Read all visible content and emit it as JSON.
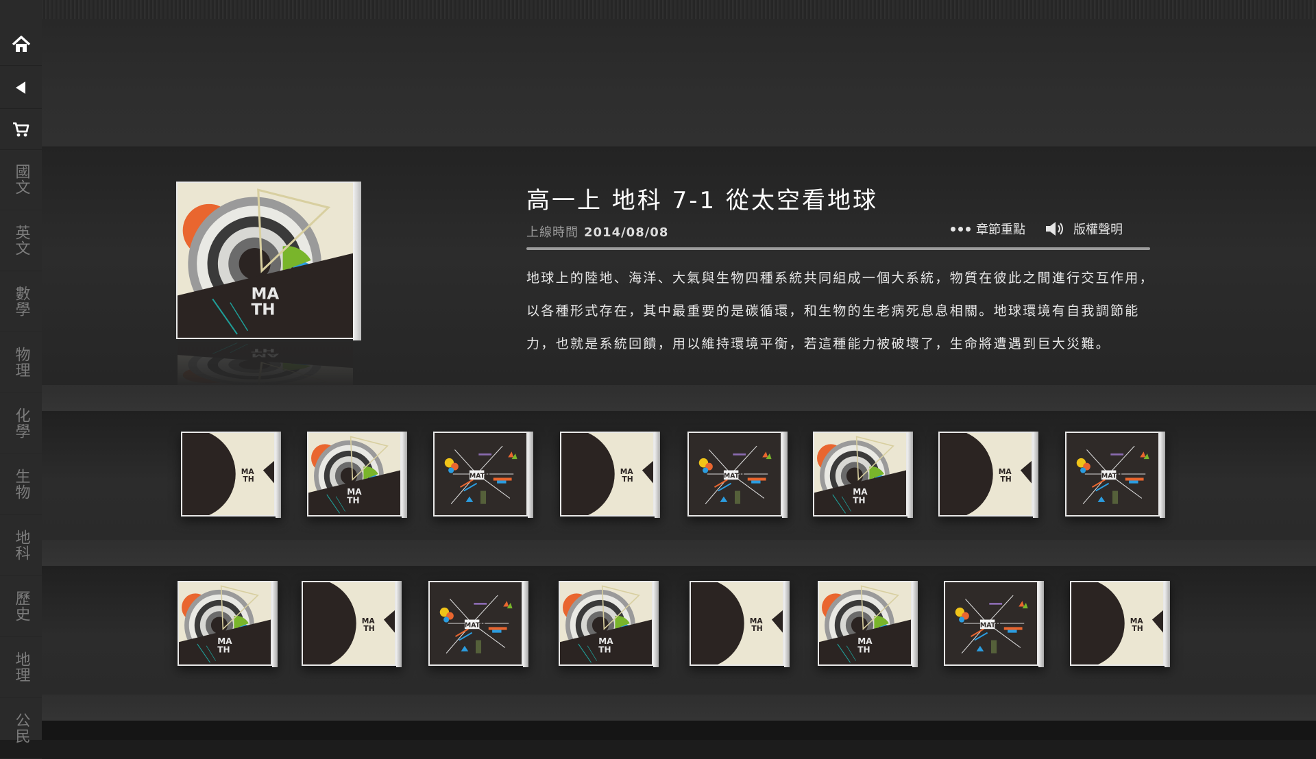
{
  "sidebar": {
    "icons": [
      "home-icon",
      "back-icon",
      "cart-icon"
    ],
    "subjects": [
      "國文",
      "英文",
      "數學",
      "物理",
      "化學",
      "生物",
      "地科",
      "歷史",
      "地理",
      "公民"
    ]
  },
  "book": {
    "title": "高一上 地科 7-1 從太空看地球",
    "date_label": "上線時間",
    "date": "2014/08/08",
    "action_chapter": "章節重點",
    "action_copyright": "版權聲明",
    "description": "地球上的陸地、海洋、大氣與生物四種系統共同組成一個大系統，物質在彼此之間進行交互作用，以各種形式存在，其中最重要的是碳循環，和生物的生老病死息息相關。地球環境有自我調節能力，也就是系統回饋，用以維持環境平衡，若這種能力被破壞了，生命將遭遇到巨大災難。",
    "cover_text": "MATH"
  },
  "shelves": {
    "row1": [
      "half-circle",
      "arcs",
      "burst",
      "half-circle",
      "burst",
      "arcs",
      "half-circle",
      "burst"
    ],
    "row2": [
      "arcs",
      "half-circle",
      "burst",
      "arcs",
      "half-circle",
      "arcs",
      "burst",
      "half-circle"
    ]
  },
  "colors": {
    "cover_bg": "#ebe6d2",
    "cover_dark": "#2b2422",
    "cover_orange": "#e9662f",
    "cover_blue": "#2b9de0",
    "cover_green": "#79b52b"
  }
}
